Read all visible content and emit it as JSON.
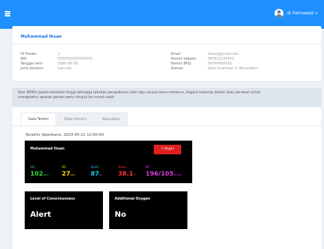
{
  "header": {
    "user_name": "dr Fatmawati",
    "caret": "▾"
  },
  "patient": {
    "name": "Muhammad Ihsan",
    "left_fields": [
      {
        "label": "ID Pasien",
        "value": "2"
      },
      {
        "label": "NIK",
        "value": "5555555555555555"
      },
      {
        "label": "Tanggal lahir",
        "value": "1990-06-29"
      },
      {
        "label": "Jenis kelamin",
        "value": "Laki-laki"
      }
    ],
    "right_fields": [
      {
        "label": "Email",
        "value": "ihsan@gmail.com"
      },
      {
        "label": "Nomor telepon",
        "value": "087812134455"
      },
      {
        "label": "Nomor BPJS",
        "value": "00000000001"
      },
      {
        "label": "Alamat",
        "value": "Jalan Imamsari X, Banjarbaru"
      }
    ]
  },
  "alert": {
    "line1": "Skor NEWS pasien beresiko tinggi sehingga lakukan pengukuran vital sign secara terus-menerus. Segera hubungi dokter atau perawat untuk",
    "line2": "mengetahui apakah pasien perlu dirujuk ke rumah sakit."
  },
  "tabs": [
    "Data Terkini",
    "Data Historis",
    "Konsultasi"
  ],
  "main": {
    "updated": "Terakhir diperbarui: 2023-05-21 12:00:00",
    "vitals": {
      "name": "Muhammad Ihsan",
      "news_badge": "7 (High)",
      "hr": {
        "label": "HR",
        "value": "102",
        "unit": "bpm"
      },
      "rr": {
        "label": "RR",
        "value": "27",
        "unit": "rpm"
      },
      "spo2": {
        "label": "SpO2",
        "value": "87",
        "unit": "%"
      },
      "temp": {
        "label": "Temp",
        "value": "38.1",
        "unit": "°C"
      },
      "bp": {
        "label": "BP",
        "value": "196/105",
        "unit": "mmHg"
      }
    },
    "consciousness": {
      "title": "Level of Consciousness",
      "value": "Alert"
    },
    "oxygen": {
      "title": "Additional Oxygen",
      "value": "No"
    }
  },
  "colors": {
    "brand": "#1e90ff",
    "hr": "#3ddc3d",
    "rr": "#ffd400",
    "spo2": "#19c9e6",
    "temp": "#ff3030",
    "bp": "#d93bd9",
    "news": "#e02020"
  }
}
